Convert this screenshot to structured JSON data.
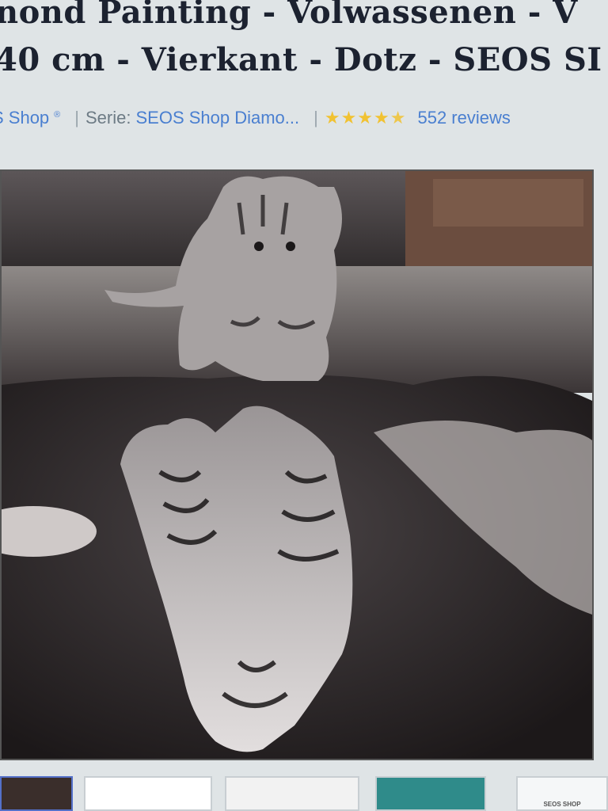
{
  "header": {
    "title_line1": "nond Painting - Volwassenen - V",
    "title_line2": "40 cm - Vierkant - Dotz - SEOS SI"
  },
  "meta": {
    "brand_link": "S Shop",
    "series_label": "Serie:",
    "series_link": "SEOS Shop Diamo...",
    "rating_stars": 4.5,
    "reviews": "552 reviews"
  },
  "gallery": {
    "main_image_alt": "Kitten looking at tiger reflection in puddle",
    "thumbs": [
      {
        "label": ""
      },
      {
        "label": ""
      },
      {
        "label": ""
      },
      {
        "label": ""
      },
      {
        "label": "SEOS SHOP"
      }
    ]
  },
  "colors": {
    "accent": "#4a7fd0",
    "star": "#f1c232",
    "title": "#1c2230"
  }
}
